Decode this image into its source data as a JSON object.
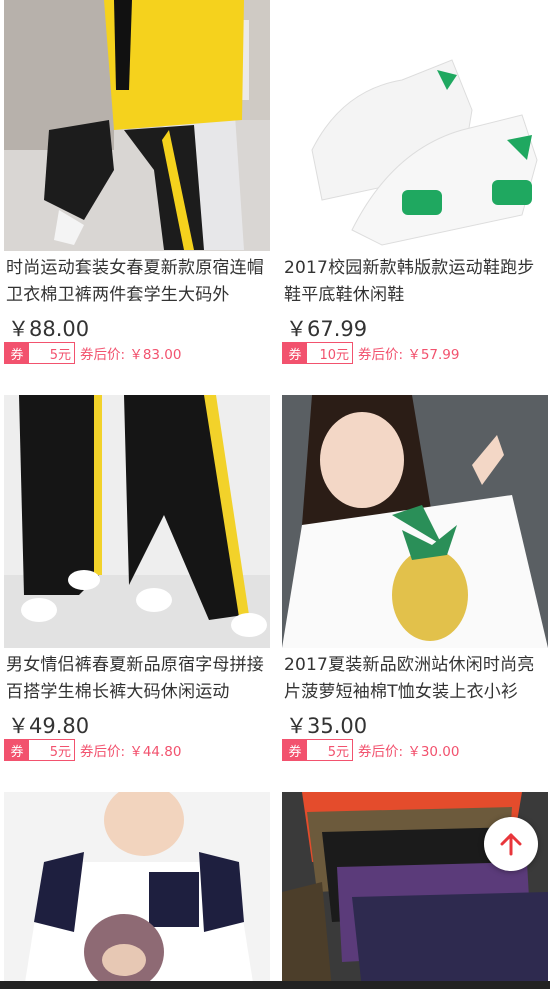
{
  "products": [
    {
      "title": "时尚运动套装女春夏新款原宿连帽卫衣棉卫裤两件套学生大码外",
      "price": "￥88.00",
      "coupon_label": "券",
      "coupon_amount": "5元",
      "after_price": "券后价: ￥83.00",
      "image": "yellow-hoodie-tracksuit"
    },
    {
      "title": "2017校园新款韩版款运动鞋跑步鞋平底鞋休闲鞋",
      "price": "￥67.99",
      "coupon_label": "券",
      "coupon_amount": "10元",
      "after_price": "券后价: ￥57.99",
      "image": "white-green-sneakers"
    },
    {
      "title": "男女情侣裤春夏新品原宿字母拼接百搭学生棉长裤大码休闲运动",
      "price": "￥49.80",
      "coupon_label": "券",
      "coupon_amount": "5元",
      "after_price": "券后价: ￥44.80",
      "image": "black-track-pants"
    },
    {
      "title": "2017夏装新品欧洲站休闲时尚亮片菠萝短袖棉T恤女装上衣小衫",
      "price": "￥35.00",
      "coupon_label": "券",
      "coupon_amount": "5元",
      "after_price": "券后价: ￥30.00",
      "image": "pineapple-tshirt"
    },
    {
      "image": "kids-bear-tshirt"
    },
    {
      "image": "stacked-tshirts"
    }
  ],
  "colors": {
    "accent": "#f2526e",
    "text": "#333333"
  },
  "icons": {
    "back_to_top": "arrow-up-icon"
  }
}
